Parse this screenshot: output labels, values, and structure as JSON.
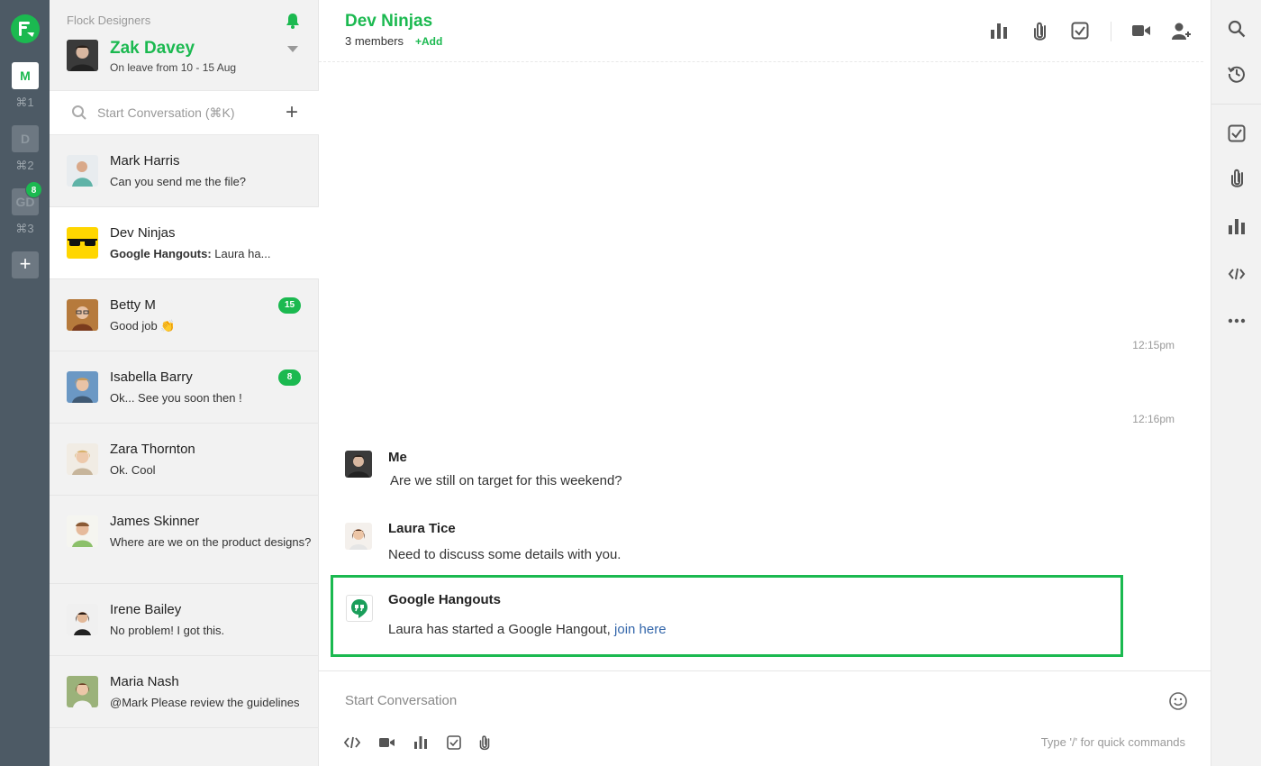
{
  "workspaces": [
    {
      "label": "M",
      "shortcut": "⌘1"
    },
    {
      "label": "D",
      "shortcut": "⌘2"
    },
    {
      "label": "GD",
      "shortcut": "⌘3",
      "badge": "8"
    }
  ],
  "add_workspace": "+",
  "sidebar": {
    "team_name": "Flock Designers",
    "user": {
      "name": "Zak Davey",
      "status": "On leave from 10 - 15 Aug"
    },
    "search_placeholder": "Start Conversation (⌘K)",
    "new_conversation": "+",
    "conversations": [
      {
        "name": "Mark Harris",
        "preview": "Can you send me the file?",
        "unread": ""
      },
      {
        "name": "Dev Ninjas",
        "preview_source": "Google Hangouts:",
        "preview": " Laura ha...",
        "unread": ""
      },
      {
        "name": "Betty M",
        "preview": "Good job 👏",
        "unread": "15"
      },
      {
        "name": "Isabella Barry",
        "preview": "Ok... See you soon then !",
        "unread": "8"
      },
      {
        "name": "Zara Thornton",
        "preview": "Ok. Cool",
        "unread": ""
      },
      {
        "name": "James Skinner",
        "preview": "Where are we on the product designs?",
        "unread": ""
      },
      {
        "name": "Irene Bailey",
        "preview": "No problem! I got this.",
        "unread": ""
      },
      {
        "name": "Maria Nash",
        "preview": "@Mark Please review the guidelines",
        "unread": ""
      }
    ]
  },
  "channel": {
    "title": "Dev Ninjas",
    "members": "3 members",
    "add_label": "+Add"
  },
  "messages": {
    "timestamps": [
      "12:15pm",
      "12:16pm"
    ],
    "items": [
      {
        "author": "Me",
        "text": "Are we still on target for this weekend?"
      },
      {
        "author": "Laura Tice",
        "text": "Need to discuss some details with you."
      }
    ],
    "hangout": {
      "author": "Google Hangouts",
      "text": "Laura has started a Google Hangout, ",
      "link": "join here"
    }
  },
  "composer": {
    "placeholder": "Start Conversation",
    "hint": "Type '/' for quick commands"
  },
  "colors": {
    "accent": "#1bb950",
    "rail": "#4d5a65",
    "link": "#3366aa"
  }
}
